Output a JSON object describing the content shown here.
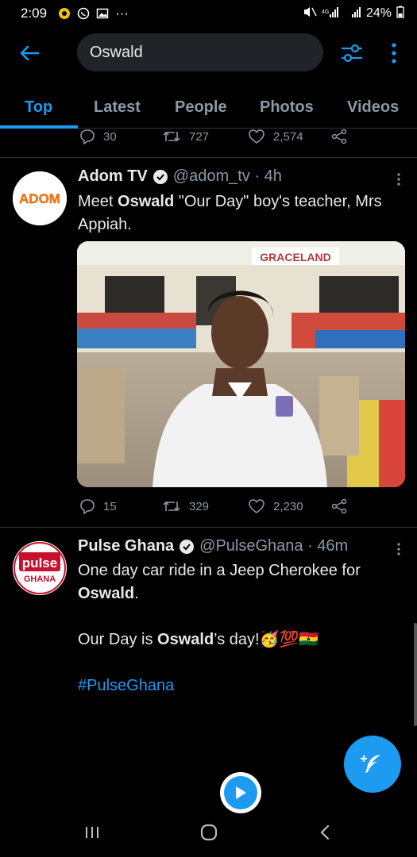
{
  "status_bar": {
    "time": "2:09",
    "battery": "24%",
    "more": "···"
  },
  "search": {
    "query": "Oswald"
  },
  "tabs": [
    {
      "label": "Top",
      "active": true
    },
    {
      "label": "Latest",
      "active": false
    },
    {
      "label": "People",
      "active": false
    },
    {
      "label": "Photos",
      "active": false
    },
    {
      "label": "Videos",
      "active": false
    }
  ],
  "prev_tweet_actions": {
    "replies": "30",
    "retweets": "727",
    "likes": "2,574"
  },
  "tweets": [
    {
      "name": "Adom TV",
      "handle": "@adom_tv · 4h",
      "avatar_text": "ADOM",
      "text_parts": [
        "Meet ",
        "Oswald",
        " \"Our Day\" boy's teacher, Mrs Appiah."
      ],
      "media_sign": "GRACELAND",
      "actions": {
        "replies": "15",
        "retweets": "329",
        "likes": "2,230"
      }
    },
    {
      "name": "Pulse Ghana",
      "handle": "@PulseGhana · 46m",
      "avatar_text_top": "pulse",
      "avatar_text_bottom": "GHANA",
      "line1_a": "One day car ride in a Jeep Cherokee for ",
      "line1_b": "Oswald",
      "line1_c": ".",
      "line2_a": "Our Day is ",
      "line2_b": "Oswald",
      "line2_c": "’s day!",
      "emoji_text": "🥳💯🇬🇭",
      "hashtag": "#PulseGhana"
    }
  ],
  "colors": {
    "accent": "#1d9bf0",
    "background": "#000000",
    "secondary_text": "#8b98a5"
  }
}
